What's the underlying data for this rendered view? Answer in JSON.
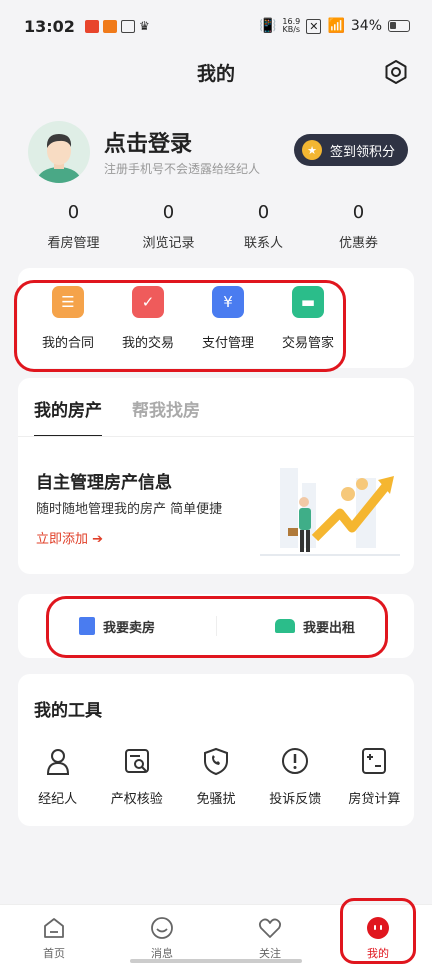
{
  "status_bar": {
    "time": "13:02",
    "net_speed_value": "16.9",
    "net_speed_unit": "KB/s",
    "battery": "34%"
  },
  "header": {
    "title": "我的"
  },
  "profile": {
    "login_title": "点击登录",
    "login_subtitle": "注册手机号不会透露给经纪人",
    "signin_button": "签到领积分"
  },
  "stats": [
    {
      "value": "0",
      "label": "看房管理"
    },
    {
      "value": "0",
      "label": "浏览记录"
    },
    {
      "value": "0",
      "label": "联系人"
    },
    {
      "value": "0",
      "label": "优惠券"
    }
  ],
  "trade_items": [
    {
      "label": "我的合同",
      "icon": "contract-icon",
      "color": "#f5a34a"
    },
    {
      "label": "我的交易",
      "icon": "transaction-icon",
      "color": "#ef5b5b"
    },
    {
      "label": "支付管理",
      "icon": "payment-icon",
      "color": "#4a7cf0"
    },
    {
      "label": "交易管家",
      "icon": "wallet-icon",
      "color": "#2bbd8a"
    }
  ],
  "property": {
    "tabs": [
      {
        "label": "我的房产",
        "active": true
      },
      {
        "label": "帮我找房",
        "active": false
      }
    ],
    "promo_title": "自主管理房产信息",
    "promo_subtitle": "随时随地管理我的房产 简单便捷",
    "promo_link": "立即添加 ➔"
  },
  "actions": {
    "sell": "我要卖房",
    "rent": "我要出租"
  },
  "tools": {
    "title": "我的工具",
    "items": [
      {
        "label": "经纪人",
        "icon": "agent-icon"
      },
      {
        "label": "产权核验",
        "icon": "verify-icon"
      },
      {
        "label": "免骚扰",
        "icon": "no-disturb-icon"
      },
      {
        "label": "投诉反馈",
        "icon": "complaint-icon"
      },
      {
        "label": "房贷计算",
        "icon": "calculator-icon"
      }
    ]
  },
  "nav": [
    {
      "label": "首页",
      "icon": "home-icon",
      "active": false
    },
    {
      "label": "消息",
      "icon": "message-icon",
      "active": false
    },
    {
      "label": "关注",
      "icon": "heart-icon",
      "active": false
    },
    {
      "label": "我的",
      "icon": "profile-icon",
      "active": true
    }
  ],
  "colors": {
    "accent": "#e0161e",
    "signin_bg": "#2f3344",
    "coin": "#f2b632",
    "link": "#e0402a"
  }
}
